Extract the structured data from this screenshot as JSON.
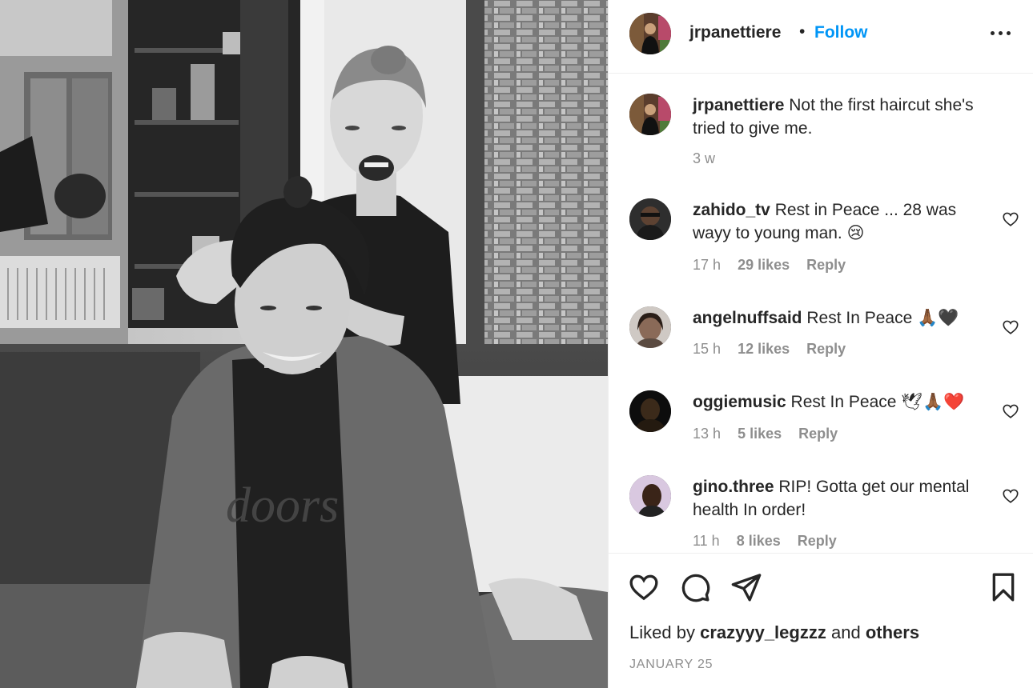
{
  "post": {
    "author": "jrpanettiere",
    "separator": "•",
    "follow_label": "Follow",
    "more_icon": "more-horizontal-icon"
  },
  "photo": {
    "shirt_text": "doors"
  },
  "caption": {
    "username": "jrpanettiere",
    "text": "Not the first haircut she's tried to give me.",
    "time": "3 w"
  },
  "comments": [
    {
      "username": "zahido_tv",
      "text": "Rest in Peace ... 28 was wayy to young man. 😢",
      "time": "17 h",
      "likes": "29 likes",
      "reply": "Reply"
    },
    {
      "username": "angelnuffsaid",
      "text": "Rest In Peace 🙏🏾🖤",
      "time": "15 h",
      "likes": "12 likes",
      "reply": "Reply"
    },
    {
      "username": "oggiemusic",
      "text": "Rest In Peace 🕊🙏🏾❤️",
      "time": "13 h",
      "likes": "5 likes",
      "reply": "Reply"
    },
    {
      "username": "gino.three",
      "text": "RIP! Gotta get our mental health In order!",
      "time": "11 h",
      "likes": "8 likes",
      "reply": "Reply"
    }
  ],
  "actions": {
    "like_icon": "heart-icon",
    "comment_icon": "comment-icon",
    "share_icon": "paper-plane-icon",
    "save_icon": "bookmark-icon"
  },
  "likes_line": {
    "prefix": "Liked by",
    "user": "crazyyy_legzzz",
    "and": "and",
    "others": "others"
  },
  "date": "JANUARY 25",
  "colors": {
    "link_blue": "#0095f6",
    "text": "#262626",
    "secondary": "#8e8e8e",
    "divider": "#efefef"
  }
}
